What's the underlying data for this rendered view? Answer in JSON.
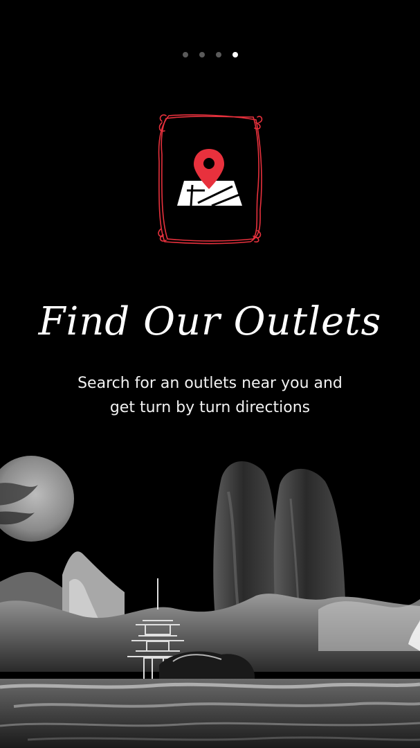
{
  "onboarding": {
    "pages_total": 4,
    "current_page": 4,
    "title": "Find Our Outlets",
    "subtitle_line1": "Search for an outlets near you and",
    "subtitle_line2": "get turn by turn directions"
  },
  "icons": {
    "frame": "ornate-frame-icon",
    "main": "map-location-pin-icon"
  },
  "colors": {
    "background": "#000000",
    "accent": "#e8313d",
    "text": "#ffffff",
    "dot_inactive": "#5a5a5a",
    "dot_active": "#ffffff"
  }
}
